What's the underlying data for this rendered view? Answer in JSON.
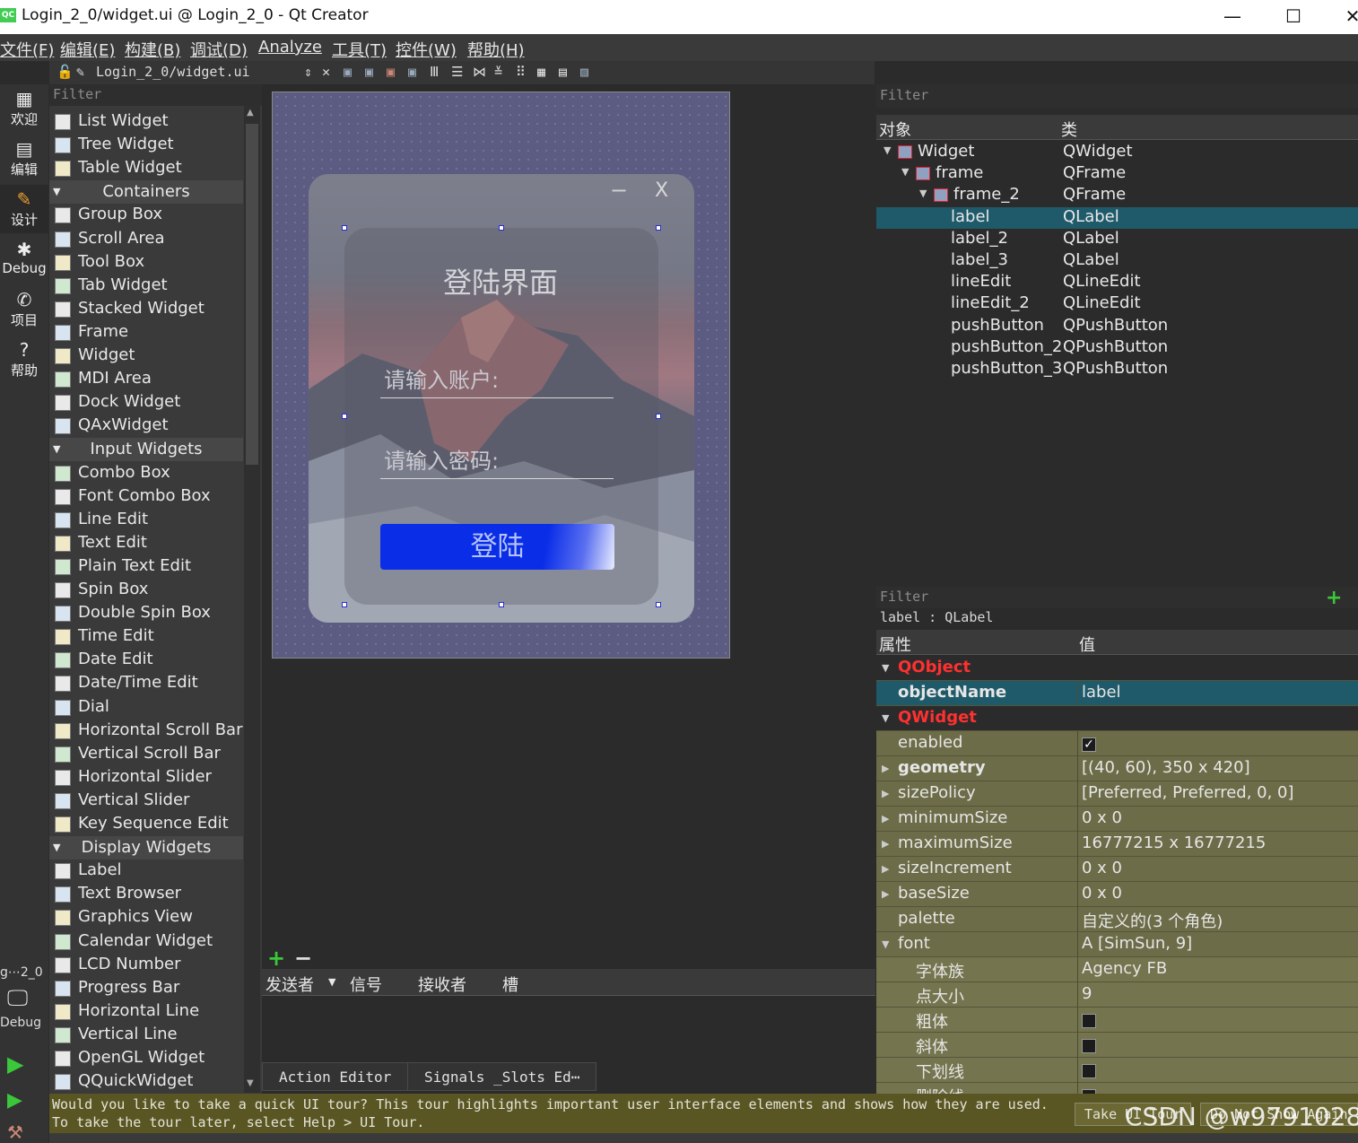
{
  "window": {
    "title": "Login_2_0/widget.ui @ Login_2_0 - Qt Creator",
    "app_icon": "QC"
  },
  "menu": [
    "文件(F)",
    "编辑(E)",
    "构建(B)",
    "调试(D)",
    "Analyze",
    "工具(T)",
    "控件(W)",
    "帮助(H)"
  ],
  "doc_toolbar": {
    "file": "Login_2_0/widget.ui"
  },
  "modes": [
    {
      "label": "欢迎",
      "icon": "grid-icon"
    },
    {
      "label": "编辑",
      "icon": "document-icon"
    },
    {
      "label": "设计",
      "icon": "pencil-icon"
    },
    {
      "label": "Debug",
      "icon": "bug-icon"
    },
    {
      "label": "项目",
      "icon": "wrench-icon"
    },
    {
      "label": "帮助",
      "icon": "help-icon"
    }
  ],
  "left_bottom": {
    "project": "g⋯2_0",
    "kit": "Debug"
  },
  "widget_box": {
    "filter_placeholder": "Filter",
    "items": [
      {
        "type": "item",
        "label": "List Widget"
      },
      {
        "type": "item",
        "label": "Tree Widget"
      },
      {
        "type": "item",
        "label": "Table Widget"
      },
      {
        "type": "cat",
        "label": "Containers"
      },
      {
        "type": "item",
        "label": "Group Box"
      },
      {
        "type": "item",
        "label": "Scroll Area"
      },
      {
        "type": "item",
        "label": "Tool Box"
      },
      {
        "type": "item",
        "label": "Tab Widget"
      },
      {
        "type": "item",
        "label": "Stacked Widget"
      },
      {
        "type": "item",
        "label": "Frame"
      },
      {
        "type": "item",
        "label": "Widget"
      },
      {
        "type": "item",
        "label": "MDI Area"
      },
      {
        "type": "item",
        "label": "Dock Widget"
      },
      {
        "type": "item",
        "label": "QAxWidget"
      },
      {
        "type": "cat",
        "label": "Input Widgets"
      },
      {
        "type": "item",
        "label": "Combo Box"
      },
      {
        "type": "item",
        "label": "Font Combo Box"
      },
      {
        "type": "item",
        "label": "Line Edit"
      },
      {
        "type": "item",
        "label": "Text Edit"
      },
      {
        "type": "item",
        "label": "Plain Text Edit"
      },
      {
        "type": "item",
        "label": "Spin Box"
      },
      {
        "type": "item",
        "label": "Double Spin Box"
      },
      {
        "type": "item",
        "label": "Time Edit"
      },
      {
        "type": "item",
        "label": "Date Edit"
      },
      {
        "type": "item",
        "label": "Date/Time Edit"
      },
      {
        "type": "item",
        "label": "Dial"
      },
      {
        "type": "item",
        "label": "Horizontal Scroll Bar"
      },
      {
        "type": "item",
        "label": "Vertical Scroll Bar"
      },
      {
        "type": "item",
        "label": "Horizontal Slider"
      },
      {
        "type": "item",
        "label": "Vertical Slider"
      },
      {
        "type": "item",
        "label": "Key Sequence Edit"
      },
      {
        "type": "cat",
        "label": "Display Widgets"
      },
      {
        "type": "item",
        "label": "Label"
      },
      {
        "type": "item",
        "label": "Text Browser"
      },
      {
        "type": "item",
        "label": "Graphics View"
      },
      {
        "type": "item",
        "label": "Calendar Widget"
      },
      {
        "type": "item",
        "label": "LCD Number"
      },
      {
        "type": "item",
        "label": "Progress Bar"
      },
      {
        "type": "item",
        "label": "Horizontal Line"
      },
      {
        "type": "item",
        "label": "Vertical Line"
      },
      {
        "type": "item",
        "label": "OpenGL Widget"
      },
      {
        "type": "item",
        "label": "QQuickWidget"
      }
    ]
  },
  "form": {
    "min_glyph": "−",
    "close_glyph": "X",
    "title": "登陆界面",
    "account_placeholder": "请输入账户:",
    "password_placeholder": "请输入密码:",
    "login_button": "登陆"
  },
  "signals": {
    "columns": [
      "发送者",
      "信号",
      "接收者",
      "槽"
    ],
    "tabs": [
      "Action Editor",
      "Signals _Slots Ed⋯"
    ]
  },
  "object_inspector": {
    "filter_placeholder": "Filter",
    "headers": [
      "对象",
      "类"
    ],
    "rows": [
      {
        "name": "Widget",
        "cls": "QWidget",
        "depth": 0,
        "tree": true
      },
      {
        "name": "frame",
        "cls": "QFrame",
        "depth": 1,
        "tree": true
      },
      {
        "name": "frame_2",
        "cls": "QFrame",
        "depth": 2,
        "tree": true
      },
      {
        "name": "label",
        "cls": "QLabel",
        "depth": 3,
        "selected": true
      },
      {
        "name": "label_2",
        "cls": "QLabel",
        "depth": 3
      },
      {
        "name": "label_3",
        "cls": "QLabel",
        "depth": 3
      },
      {
        "name": "lineEdit",
        "cls": "QLineEdit",
        "depth": 3
      },
      {
        "name": "lineEdit_2",
        "cls": "QLineEdit",
        "depth": 3
      },
      {
        "name": "pushButton",
        "cls": "QPushButton",
        "depth": 3
      },
      {
        "name": "pushButton_2",
        "cls": "QPushButton",
        "depth": 3
      },
      {
        "name": "pushButton_3",
        "cls": "QPushButton",
        "depth": 3
      }
    ]
  },
  "property_editor": {
    "filter_placeholder": "Filter",
    "context": "label : QLabel",
    "headers": [
      "属性",
      "值"
    ],
    "rows": [
      {
        "kind": "group",
        "name": "QObject"
      },
      {
        "kind": "sel",
        "name": "objectName",
        "value": "label",
        "bold": true
      },
      {
        "kind": "group",
        "name": "QWidget"
      },
      {
        "kind": "prop",
        "name": "enabled",
        "check": "✓"
      },
      {
        "kind": "prop",
        "name": "geometry",
        "value": "[(40, 60), 350 x 420]",
        "bold": true,
        "expand": true
      },
      {
        "kind": "prop",
        "name": "sizePolicy",
        "value": "[Preferred, Preferred, 0, 0]",
        "expand": true
      },
      {
        "kind": "prop",
        "name": "minimumSize",
        "value": "0 x 0",
        "expand": true
      },
      {
        "kind": "prop",
        "name": "maximumSize",
        "value": "16777215 x 16777215",
        "expand": true
      },
      {
        "kind": "prop",
        "name": "sizeIncrement",
        "value": "0 x 0",
        "expand": true
      },
      {
        "kind": "prop",
        "name": "baseSize",
        "value": "0 x 0",
        "expand": true
      },
      {
        "kind": "prop",
        "name": "palette",
        "value": "自定义的(3 个角色)"
      },
      {
        "kind": "prop",
        "name": "font",
        "value": "A  [SimSun, 9]",
        "open": true
      },
      {
        "kind": "sub",
        "name": "字体族",
        "value": "Agency FB"
      },
      {
        "kind": "sub",
        "name": "点大小",
        "value": "9"
      },
      {
        "kind": "sub",
        "name": "粗体",
        "check": ""
      },
      {
        "kind": "sub",
        "name": "斜体",
        "check": ""
      },
      {
        "kind": "sub",
        "name": "下划线",
        "check": ""
      },
      {
        "kind": "sub",
        "name": "删除线",
        "check": ""
      }
    ]
  },
  "tour": {
    "line1": "Would you like to take a quick UI tour? This tour highlights important user interface elements and shows how they are used.",
    "line2": "To take the tour later, select Help > UI Tour.",
    "take_button": "Take UI Tour",
    "dismiss_button": "Do Not Show Again"
  },
  "watermark": "CSDN @w9791028"
}
